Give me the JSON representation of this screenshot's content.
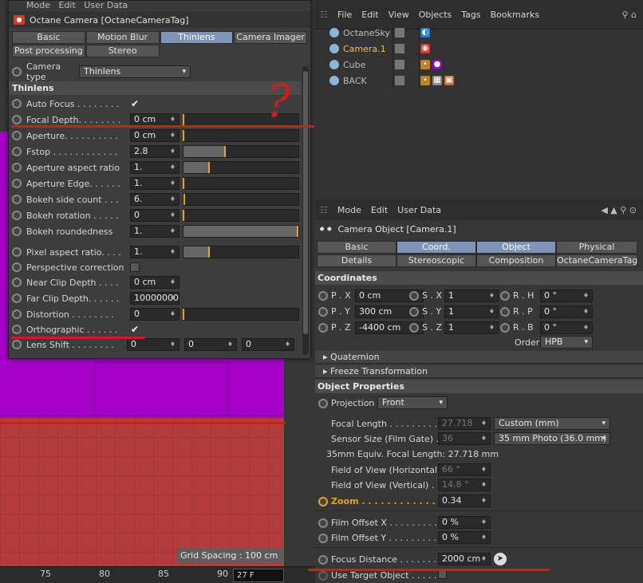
{
  "viewport": {
    "grid_label": "Grid Spacing : 100 cm",
    "ruler_ticks": [
      "75",
      "80",
      "85",
      "90"
    ],
    "frame_field": "27 F"
  },
  "tag_panel": {
    "menubar": {
      "items": [
        "Mode",
        "Edit",
        "User Data"
      ]
    },
    "title": "Octane Camera [OctaneCameraTag]",
    "tabs_row1": [
      "Basic",
      "Motion Blur",
      "Thinlens",
      "Camera Imager"
    ],
    "tabs_row2": [
      "Post processing",
      "Stereo"
    ],
    "camera_type": {
      "label": "Camera type",
      "value": "Thinlens"
    },
    "section": "Thinlens",
    "rows": [
      {
        "label": "Auto Focus . . . . . . . .",
        "kind": "check",
        "checked": true
      },
      {
        "label": "Focal Depth. . . . . . . .",
        "kind": "num",
        "value": "0 cm",
        "fill": 0.0,
        "mark": 0.0
      },
      {
        "label": "Aperture. . . . . . . . . .",
        "kind": "num",
        "value": "0 cm",
        "fill": 0.0,
        "mark": 0.0
      },
      {
        "label": "Fstop . . . . . . . . . . . .",
        "kind": "num",
        "value": "2.8",
        "fill": 0.36,
        "mark": 0.36
      },
      {
        "label": "Aperture aspect ratio",
        "kind": "num",
        "value": "1.",
        "fill": 0.22,
        "mark": 0.22
      },
      {
        "label": "Aperture Edge. . . . . .",
        "kind": "num",
        "value": "1.",
        "fill": 0.0,
        "mark": 0.0
      },
      {
        "label": "Bokeh side count . . .",
        "kind": "num",
        "value": "6.",
        "fill": 0.0,
        "mark": 0.01
      },
      {
        "label": "Bokeh rotation . . . . .",
        "kind": "num",
        "value": "0",
        "fill": 0.0,
        "mark": 0.0
      },
      {
        "label": "Bokeh roundedness",
        "kind": "num",
        "value": "1.",
        "fill": 1.0,
        "mark": 0.99
      },
      {
        "label": "Pixel aspect ratio. . . .",
        "kind": "num",
        "value": "1.",
        "fill": 0.22,
        "mark": 0.22
      },
      {
        "label": "Perspective correction",
        "kind": "check",
        "checked": false
      },
      {
        "label": "Near Clip Depth  . . . .",
        "kind": "num",
        "value": "0 cm"
      },
      {
        "label": "Far Clip Depth. . . . . .",
        "kind": "num",
        "value": "10000000"
      },
      {
        "label": "Distortion  . . . . . . . .",
        "kind": "num",
        "value": "0",
        "fill": 0.0,
        "mark": 0.0
      },
      {
        "label": "Orthographic . . . . . .",
        "kind": "check",
        "checked": true
      },
      {
        "label": "Lens Shift . . . . . . . .",
        "kind": "triple",
        "values": [
          "0",
          "0",
          "0"
        ]
      }
    ]
  },
  "object_manager": {
    "menubar": [
      "File",
      "Edit",
      "View",
      "Objects",
      "Tags",
      "Bookmarks"
    ],
    "objects": [
      {
        "name": "OctaneSky",
        "color": "#bbbbbb"
      },
      {
        "name": "Camera.1",
        "color": "#f0c040"
      },
      {
        "name": "Cube",
        "color": "#bbbbbb"
      },
      {
        "name": "BACK",
        "color": "#bbbbbb"
      }
    ]
  },
  "attributes": {
    "menubar": [
      "Mode",
      "Edit",
      "User Data"
    ],
    "title": "Camera Object [Camera.1]",
    "tabs_row1": [
      "Basic",
      "Coord.",
      "Object",
      "Physical"
    ],
    "tabs_row2": [
      "Details",
      "Stereoscopic",
      "Composition",
      "OctaneCameraTag"
    ],
    "coordinates_header": "Coordinates",
    "coords": [
      {
        "p_label": "P . X",
        "p_val": "0 cm",
        "s_label": "S . X",
        "s_val": "1",
        "r_label": "R . H",
        "r_val": "0 °"
      },
      {
        "p_label": "P . Y",
        "p_val": "300 cm",
        "s_label": "S . Y",
        "s_val": "1",
        "r_label": "R . P",
        "r_val": "0 °"
      },
      {
        "p_label": "P . Z",
        "p_val": "-4400 cm",
        "s_label": "S . Z",
        "s_val": "1",
        "r_label": "R . B",
        "r_val": "0 °"
      }
    ],
    "order_label": "Order",
    "order_value": "HPB",
    "quaternion": "Quaternion",
    "freeze": "Freeze Transformation",
    "object_properties": "Object Properties",
    "projection": {
      "label": "Projection",
      "value": "Front"
    },
    "focal_length": {
      "label": "Focal Length . . . . . . . . . .",
      "value": "27.718",
      "dropdown": "Custom (mm)"
    },
    "sensor_size": {
      "label": "Sensor Size (Film Gate) . .",
      "value": "36",
      "dropdown": "35 mm Photo (36.0 mm)"
    },
    "equiv": "35mm Equiv. Focal Length:  27.718 mm",
    "fov_h": {
      "label": "Field of View (Horizontal)",
      "value": "66 °"
    },
    "fov_v": {
      "label": "Field of View (Vertical) . .",
      "value": "14.8 °"
    },
    "zoom": {
      "label": "Zoom . . . . . . . . . . . . . . .",
      "value": "0.34"
    },
    "film_offset_x": {
      "label": "Film Offset X . . . . . . . . . .",
      "value": "0 %"
    },
    "film_offset_y": {
      "label": "Film Offset Y . . . . . . . . . .",
      "value": "0 %"
    },
    "focus_distance": {
      "label": "Focus Distance . . . . . . . .",
      "value": "2000 cm"
    },
    "use_target": {
      "label": "Use Target Object . . . . . ."
    }
  },
  "annotation": {
    "question_mark": "?",
    "color": "#d21b1b"
  }
}
